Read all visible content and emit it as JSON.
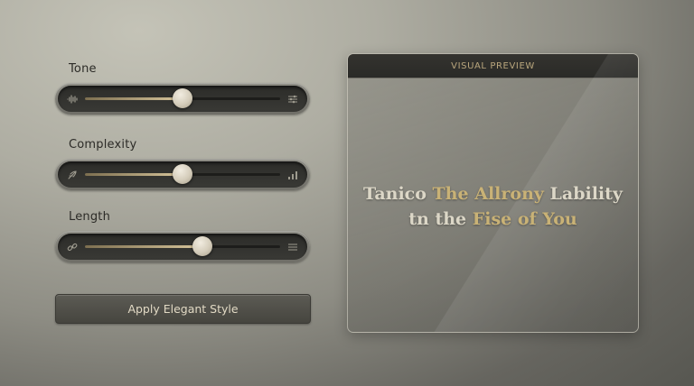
{
  "controls": {
    "tone": {
      "label": "Tone",
      "value": 0.5,
      "left_icon": "waveform-icon",
      "right_icon": "sliders-icon"
    },
    "complexity": {
      "label": "Complexity",
      "value": 0.5,
      "left_icon": "feather-icon",
      "right_icon": "bar-chart-icon"
    },
    "length": {
      "label": "Length",
      "value": 0.6,
      "left_icon": "link-icon",
      "right_icon": "list-icon"
    }
  },
  "apply_button": {
    "label": "Apply Elegant Style"
  },
  "preview": {
    "header": "VISUAL PREVIEW",
    "line1_a": "Tanico ",
    "line1_b": "The Allrony",
    "line1_c": " Lability",
    "line2_a": "tn the ",
    "line2_b": "Fise of You"
  },
  "colors": {
    "accent_gold": "#c9b276",
    "thumb": "#d4ccba",
    "track": "#1d1d1b",
    "button_text": "#e1d9c4"
  }
}
